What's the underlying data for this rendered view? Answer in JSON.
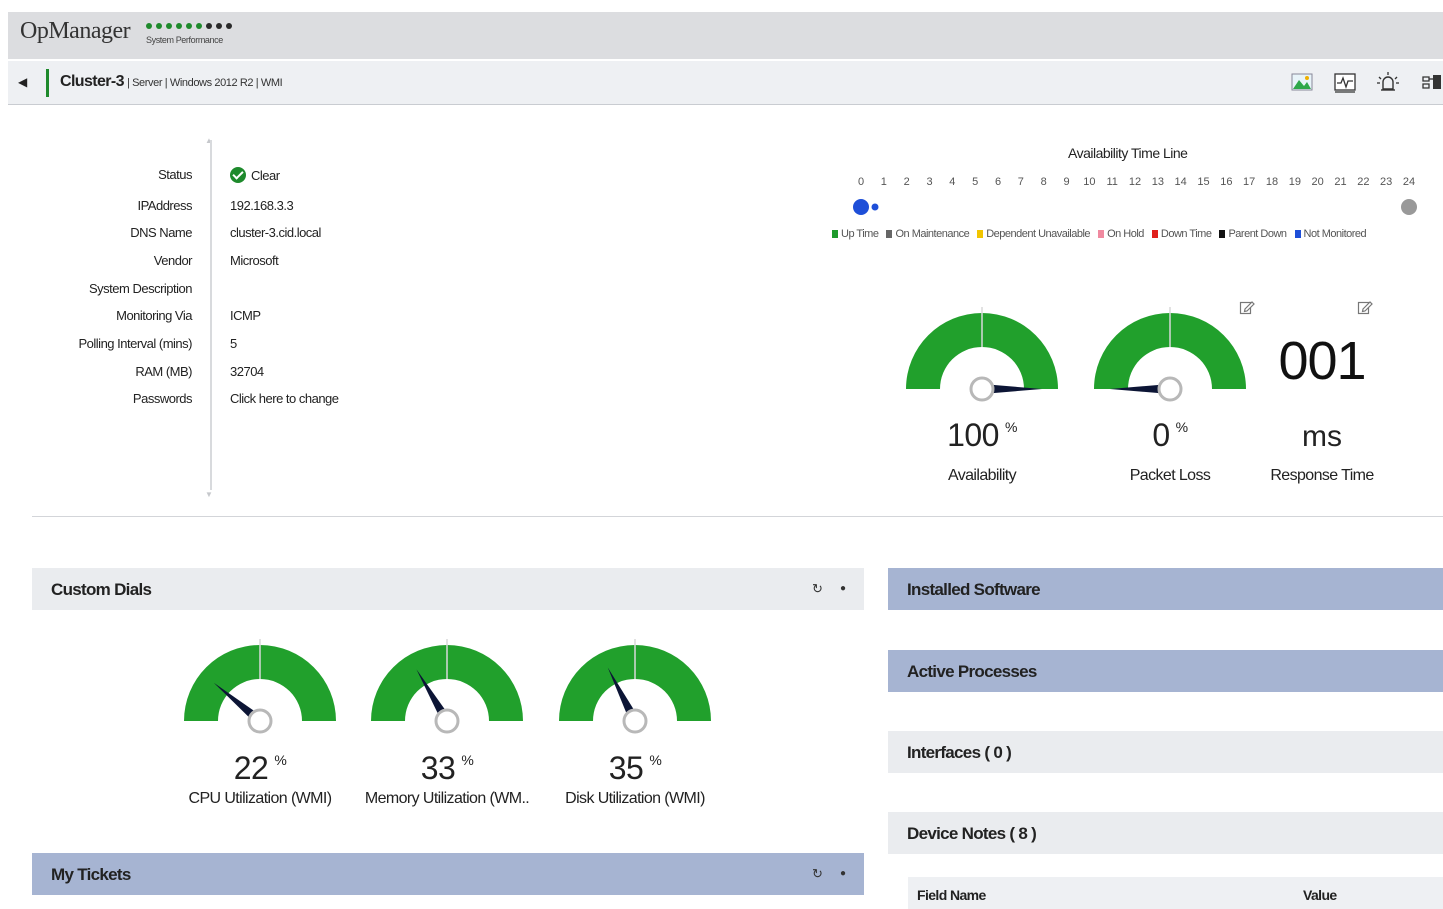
{
  "app": {
    "title": "OpManager",
    "brand_subtitle": "System Performance"
  },
  "device": {
    "name": "Cluster-3",
    "meta": "| Server | Windows 2012 R2 | WMI"
  },
  "toolbar_icons": [
    "map-icon",
    "graph-icon",
    "alarm-icon",
    "config-icon"
  ],
  "properties": [
    {
      "label": "Status",
      "value": "Clear"
    },
    {
      "label": "IPAddress",
      "value": "192.168.3.3"
    },
    {
      "label": "DNS Name",
      "value": "cluster-3.cid.local"
    },
    {
      "label": "Vendor",
      "value": "Microsoft"
    },
    {
      "label": "System Description",
      "value": ""
    },
    {
      "label": "Monitoring Via",
      "value": "ICMP"
    },
    {
      "label": "Polling Interval (mins)",
      "value": "5"
    },
    {
      "label": "RAM (MB)",
      "value": "32704"
    },
    {
      "label": "Passwords",
      "value": "Click here to change"
    }
  ],
  "availability_timeline": {
    "title": "Availability Time Line",
    "hours": [
      "0",
      "1",
      "2",
      "3",
      "4",
      "5",
      "6",
      "7",
      "8",
      "9",
      "10",
      "11",
      "12",
      "13",
      "14",
      "15",
      "16",
      "17",
      "18",
      "19",
      "20",
      "21",
      "22",
      "23",
      "24"
    ],
    "legend": [
      {
        "label": "Up Time",
        "color": "#1e9a2c"
      },
      {
        "label": "On Maintenance",
        "color": "#666666"
      },
      {
        "label": "Dependent Unavailable",
        "color": "#f2c500"
      },
      {
        "label": "On Hold",
        "color": "#f08aa0"
      },
      {
        "label": "Down Time",
        "color": "#e0201c"
      },
      {
        "label": "Parent Down",
        "color": "#111111"
      },
      {
        "label": "Not Monitored",
        "color": "#1e4fd8"
      }
    ],
    "markers": [
      {
        "hour": 0,
        "status": "Not Monitored",
        "color": "#1e4fd8"
      },
      {
        "hour": 24,
        "status": "On Maintenance",
        "color": "#999999"
      }
    ]
  },
  "summary_gauges": [
    {
      "value": "100",
      "value_num": 100,
      "unit": "%",
      "label": "Availability"
    },
    {
      "value": "0",
      "value_num": 0,
      "unit": "%",
      "label": "Packet Loss"
    }
  ],
  "response_time": {
    "value": "001",
    "unit": "ms",
    "label": "Response Time"
  },
  "custom_dials": {
    "title": "Custom Dials",
    "dials": [
      {
        "value": "22",
        "value_num": 22,
        "unit": "%",
        "label": "CPU Utilization (WMI)"
      },
      {
        "value": "33",
        "value_num": 33,
        "unit": "%",
        "label": "Memory Utilization (WM.."
      },
      {
        "value": "35",
        "value_num": 35,
        "unit": "%",
        "label": "Disk Utilization (WMI)"
      }
    ]
  },
  "my_tickets": {
    "title": "My Tickets"
  },
  "right_panels": {
    "installed_software": "Installed Software",
    "active_processes": "Active Processes",
    "interfaces": "Interfaces ( 0 )",
    "device_notes": "Device Notes ( 8 )"
  },
  "notes_table": {
    "columns": [
      "Field Name",
      "Value"
    ]
  },
  "colors": {
    "gauge_green": "#21a02c",
    "accent_green": "#1e8a2c",
    "panel_blue": "#a6b4d2",
    "panel_grey": "#eaecef"
  }
}
